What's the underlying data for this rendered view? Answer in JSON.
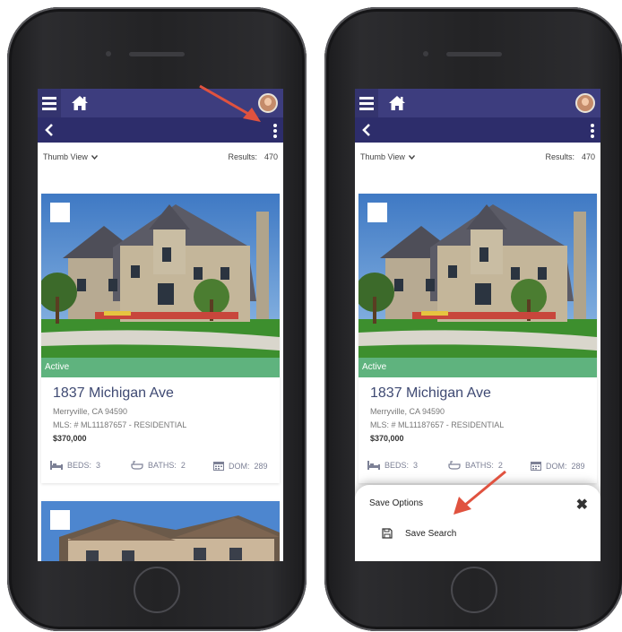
{
  "left_phone": {
    "toolbar": {
      "view_select": "Thumb View",
      "results_label": "Results:",
      "results_count": "470"
    },
    "listing": {
      "status": "Active",
      "address": "1837 Michigan Ave",
      "city": "Merryville, CA 94590",
      "mls": "MLS: # ML11187657 - RESIDENTIAL",
      "price": "$370,000",
      "beds_label": "BEDS:",
      "beds": "3",
      "baths_label": "BATHS:",
      "baths": "2",
      "dom_label": "DOM:",
      "dom": "289"
    }
  },
  "right_phone": {
    "toolbar": {
      "view_select": "Thumb View",
      "results_label": "Results:",
      "results_count": "470"
    },
    "listing": {
      "status": "Active",
      "address": "1837 Michigan Ave",
      "city": "Merryville, CA 94590",
      "mls": "MLS: # ML11187657 - RESIDENTIAL",
      "price": "$370,000",
      "beds_label": "BEDS:",
      "beds": "3",
      "baths_label": "BATHS:",
      "baths": "2",
      "dom_label": "DOM:",
      "dom": "289"
    },
    "save_sheet": {
      "title": "Save Options",
      "item_label": "Save Search"
    }
  },
  "colors": {
    "navbar": "#3d3d7e",
    "subbar": "#2d2d6b",
    "active_badge": "#5fb37e",
    "address_text": "#3f4a73",
    "annotation_arrow": "#e0523f"
  },
  "icons": [
    "menu-icon",
    "home-icon",
    "avatar",
    "back-arrow-icon",
    "more-vertical-icon",
    "chevron-down-icon",
    "bed-icon",
    "bath-icon",
    "calendar-icon",
    "close-icon",
    "save-icon"
  ]
}
